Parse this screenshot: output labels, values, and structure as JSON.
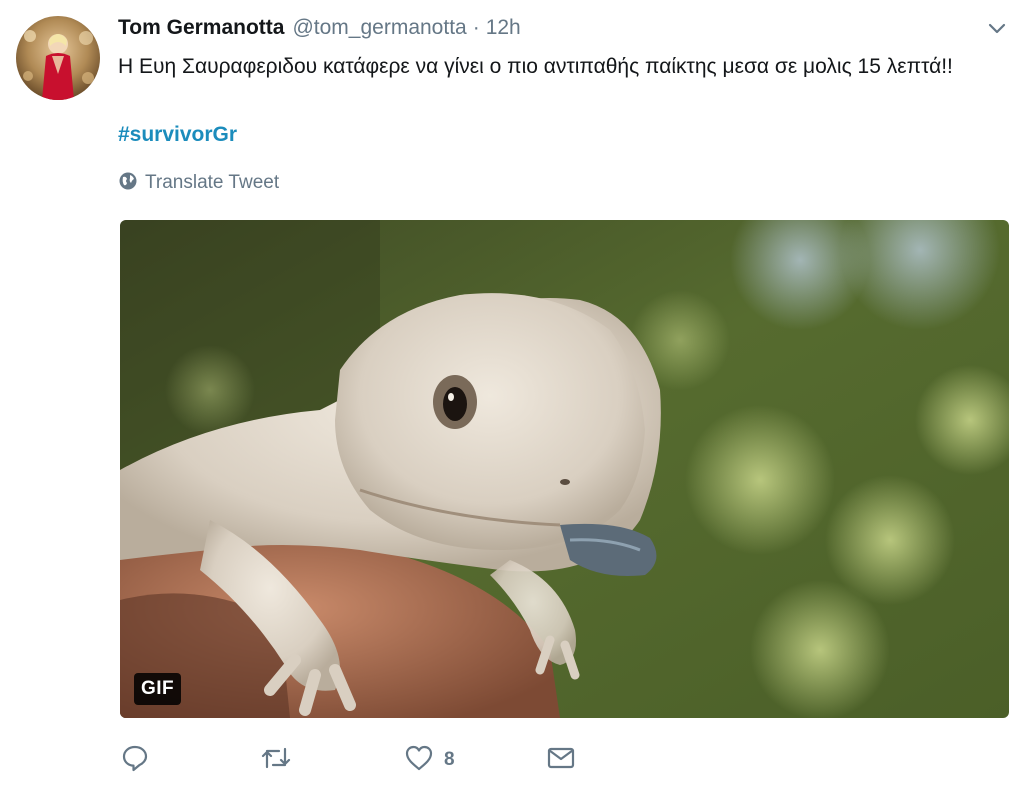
{
  "tweet": {
    "author_name": "Tom Germanotta",
    "handle": "@tom_germanotta",
    "separator": "·",
    "time": "12h",
    "text": "Η Ευη Σαυραφεριδου κατάφερε να γίνει ο πιο αντιπαθής παίκτης μεσα σε μολις 15 λεπτά!!",
    "hashtag": "#survivorGr",
    "translate_label": "Translate Tweet",
    "media_badge": "GIF",
    "like_count": "8"
  },
  "icons": {
    "menu": "chevron-down-icon",
    "translate": "globe-icon",
    "reply": "reply-icon",
    "retweet": "retweet-icon",
    "like": "heart-icon",
    "dm": "envelope-icon"
  },
  "colors": {
    "hashtag": "#1b8cbc",
    "secondary_text": "#657786",
    "primary_text": "#14171a"
  }
}
